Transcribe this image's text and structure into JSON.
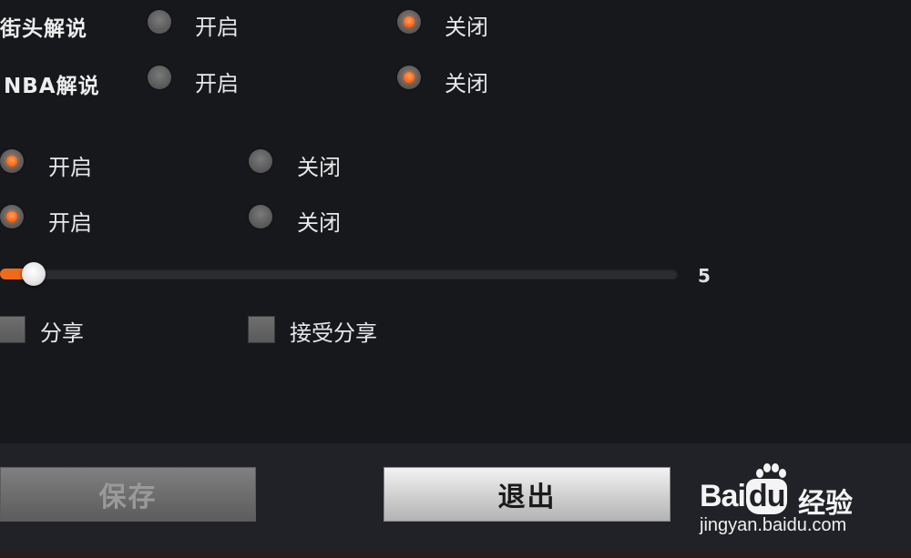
{
  "settings": {
    "street_commentary": {
      "label": "街头解说",
      "on_label": "开启",
      "off_label": "关闭",
      "selected": "off"
    },
    "nba_commentary": {
      "label": "NBA解说",
      "on_label": "开启",
      "off_label": "关闭",
      "selected": "off"
    },
    "option_3": {
      "on_label": "开启",
      "off_label": "关闭",
      "selected": "on"
    },
    "option_4": {
      "on_label": "开启",
      "off_label": "关闭",
      "selected": "on"
    },
    "slider": {
      "value_text": "5",
      "fill_fraction": 0.05
    },
    "share": {
      "label": "分享",
      "checked": false
    },
    "accept_share": {
      "label": "接受分享",
      "checked": false
    }
  },
  "buttons": {
    "save_label": "保存",
    "exit_label": "退出"
  },
  "watermark": {
    "brand_prefix": "Bai",
    "brand_du": "du",
    "brand_suffix": "经验",
    "url": "jingyan.baidu.com"
  },
  "colors": {
    "accent": "#f06a1c",
    "background": "#16181c",
    "footer": "#202227"
  }
}
